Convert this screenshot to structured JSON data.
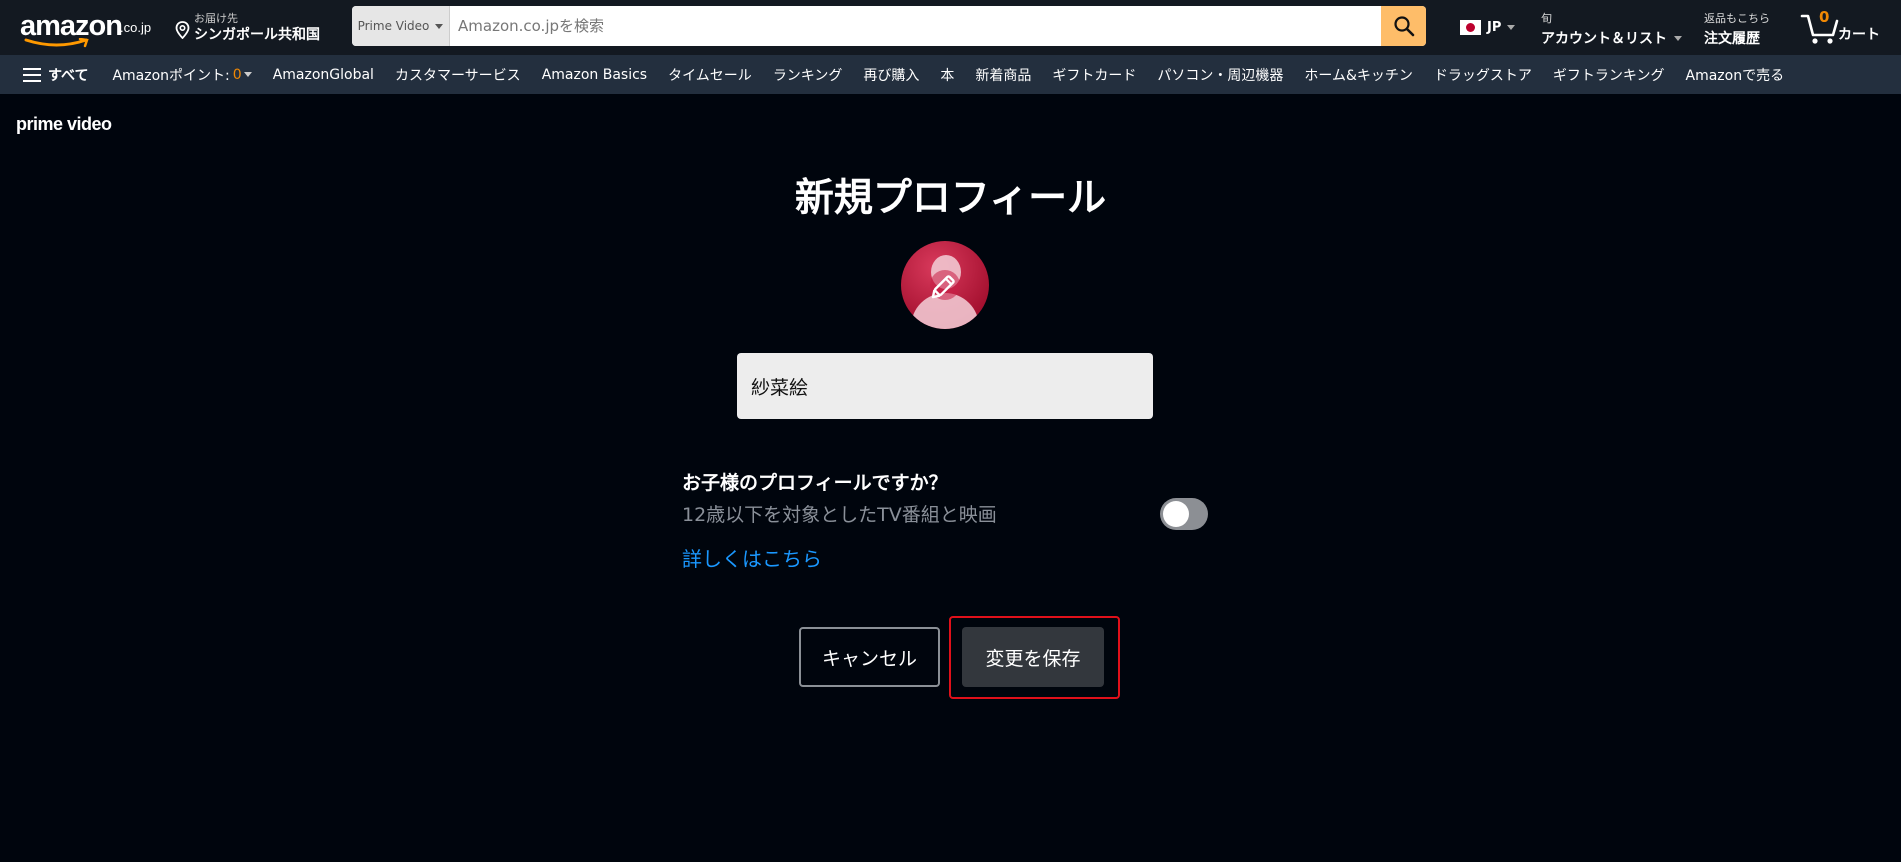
{
  "header": {
    "logo": {
      "word": "amazon",
      "tld": ".co.jp"
    },
    "deliver": {
      "line1": "お届け先",
      "line2": "シンガポール共和国"
    },
    "search": {
      "category": "Prime Video",
      "placeholder": "Amazon.co.jpを検索",
      "value": ""
    },
    "language": {
      "code": "JP"
    },
    "account": {
      "line1": "旬",
      "line2": "アカウント＆リスト"
    },
    "orders": {
      "line1": "返品もこちら",
      "line2": "注文履歴"
    },
    "cart": {
      "count": "0",
      "label": "カート"
    }
  },
  "subnav": {
    "all_label": "すべて",
    "points_label": "Amazonポイント:",
    "points_value": "0",
    "links": [
      "AmazonGlobal",
      "カスタマーサービス",
      "Amazon Basics",
      "タイムセール",
      "ランキング",
      "再び購入",
      "本",
      "新着商品",
      "ギフトカード",
      "パソコン・周辺機器",
      "ホーム&キッチン",
      "ドラッグストア",
      "ギフトランキング",
      "Amazonで売る"
    ]
  },
  "page": {
    "brand": "prime video",
    "title": "新規プロフィール",
    "name_value": "紗菜絵",
    "kids_title": "お子様のプロフィールですか？",
    "kids_subtitle": "12歳以下を対象としたTV番組と映画",
    "kids_toggle_on": false,
    "learn_more": "詳しくはこちら",
    "cancel_label": "キャンセル",
    "save_label": "変更を保存"
  },
  "colors": {
    "topbar": "#131921",
    "subbar": "#232f3e",
    "background": "#00050d",
    "search_button": "#febd69",
    "accent_orange": "#f08804",
    "link_blue": "#1a98ff",
    "highlight_red": "#e0101a"
  },
  "icons": {
    "search": "magnifier-icon",
    "location": "location-pin-icon",
    "cart": "cart-icon",
    "menu": "hamburger-icon",
    "avatar_edit": "pencil-icon"
  }
}
